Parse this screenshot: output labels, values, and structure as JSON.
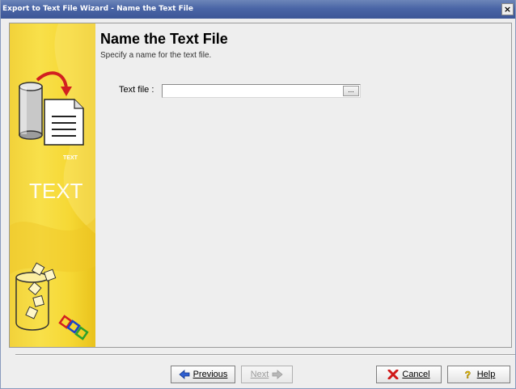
{
  "window": {
    "title": "Export to Text File Wizard - Name the Text File",
    "close_glyph": "×"
  },
  "banner": {
    "small_text": "TEXT",
    "large_text": "TEXT",
    "icons": [
      "database-to-document-icon",
      "chain-cylinder-icon"
    ]
  },
  "page": {
    "title": "Name the Text File",
    "subtitle": "Specify a name for the text file."
  },
  "form": {
    "text_file_label": "Text file :",
    "text_file_value": "",
    "browse_label": "..."
  },
  "buttons": {
    "previous": "Previous",
    "next": "Next",
    "cancel": "Cancel",
    "help": "Help"
  },
  "colors": {
    "title_bar": "#4a65a6",
    "banner": "#f6d834",
    "background": "#eeeeee",
    "arrow_blue": "#2f5fd0",
    "cancel_red": "#d01818",
    "help_yellow": "#f4c800"
  }
}
